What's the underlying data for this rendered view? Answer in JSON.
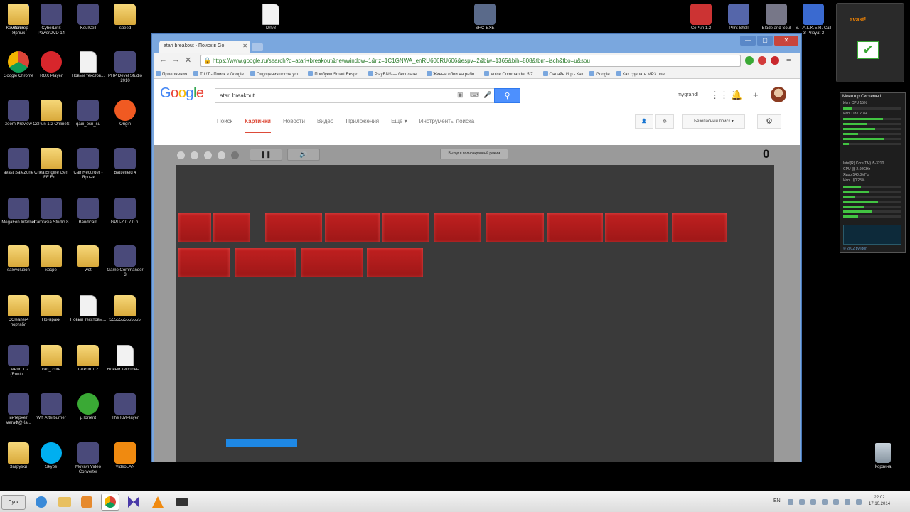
{
  "desktop": {
    "icons": [
      {
        "label": "Компьютер - Ярлык",
        "type": "computer",
        "col": 0,
        "row": 0
      },
      {
        "label": "CyberLink PowerDVD 14",
        "type": "app",
        "col": 1,
        "row": 0
      },
      {
        "label": "KeulCell",
        "type": "app",
        "col": 2,
        "row": 0
      },
      {
        "label": "speed",
        "type": "folder",
        "col": 3,
        "row": 0
      },
      {
        "label": "Game",
        "type": "folder",
        "col": 4,
        "row": 0
      },
      {
        "label": "Google Chrome",
        "type": "chrome",
        "col": 0,
        "row": 1
      },
      {
        "label": "ROX Player",
        "type": "rox",
        "col": 1,
        "row": 1
      },
      {
        "label": "Новый текстов...",
        "type": "doc",
        "col": 2,
        "row": 1
      },
      {
        "label": "PHP Devel Studio 2010",
        "type": "app",
        "col": 3,
        "row": 1
      },
      {
        "label": "zoom Preview",
        "type": "app",
        "col": 0,
        "row": 2
      },
      {
        "label": "CePun 1.2 OnlineS",
        "type": "folder",
        "col": 1,
        "row": 2
      },
      {
        "label": "qaui_osn_su",
        "type": "app",
        "col": 2,
        "row": 2
      },
      {
        "label": "Origin",
        "type": "origin",
        "col": 3,
        "row": 2
      },
      {
        "label": "avast SafeZone",
        "type": "app",
        "col": 0,
        "row": 3
      },
      {
        "label": "CheatEngine Gen FE En...",
        "type": "folder",
        "col": 1,
        "row": 3
      },
      {
        "label": "CamRecorder - Ярлык",
        "type": "app",
        "col": 2,
        "row": 3
      },
      {
        "label": "Battlefield 4",
        "type": "app",
        "col": 3,
        "row": 3
      },
      {
        "label": "MegaFon Internet",
        "type": "app",
        "col": 0,
        "row": 4
      },
      {
        "label": "Camtasia Studio 8",
        "type": "app",
        "col": 1,
        "row": 4
      },
      {
        "label": "Bandicam",
        "type": "app",
        "col": 2,
        "row": 4
      },
      {
        "label": "GPU-Z.0.7.0.ru",
        "type": "app",
        "col": 3,
        "row": 4
      },
      {
        "label": "salevolution",
        "type": "folder",
        "col": 0,
        "row": 5
      },
      {
        "label": "косре",
        "type": "folder",
        "col": 1,
        "row": 5
      },
      {
        "label": "wot",
        "type": "folder",
        "col": 2,
        "row": 5
      },
      {
        "label": "Game Commander 3",
        "type": "app",
        "col": 3,
        "row": 5
      },
      {
        "label": "CCleaner4 портабл",
        "type": "folder",
        "col": 0,
        "row": 6
      },
      {
        "label": "Призраки",
        "type": "folder",
        "col": 1,
        "row": 6
      },
      {
        "label": "Новый текстовы...",
        "type": "doc",
        "col": 2,
        "row": 6
      },
      {
        "label": "5555555555555",
        "type": "folder",
        "col": 3,
        "row": 6
      },
      {
        "label": "CePun 1.2 (Runtu...",
        "type": "app",
        "col": 0,
        "row": 7
      },
      {
        "label": "can_ cure",
        "type": "folder",
        "col": 1,
        "row": 7
      },
      {
        "label": "CePun 1.2",
        "type": "folder",
        "col": 2,
        "row": 7
      },
      {
        "label": "Новый текстовы...",
        "type": "doc",
        "col": 3,
        "row": 7
      },
      {
        "label": "интернет мегаФ@Ка...",
        "type": "app",
        "col": 0,
        "row": 8
      },
      {
        "label": "Wifi Afterburner",
        "type": "app",
        "col": 1,
        "row": 8
      },
      {
        "label": "µTorrent",
        "type": "utorrent",
        "col": 2,
        "row": 8
      },
      {
        "label": "The KMPlayer",
        "type": "app",
        "col": 3,
        "row": 8
      },
      {
        "label": "Загрузки",
        "type": "folder",
        "col": 0,
        "row": 9
      },
      {
        "label": "Skype",
        "type": "skype",
        "col": 1,
        "row": 9
      },
      {
        "label": "Movavi Video Converter",
        "type": "app",
        "col": 2,
        "row": 9
      },
      {
        "label": "VideoLAN",
        "type": "vlc",
        "col": 3,
        "row": 9
      }
    ],
    "top_icons": [
      {
        "label": "Drlv8",
        "type": "doc"
      },
      {
        "label": "SHC-EXE",
        "type": "app"
      },
      {
        "label": "CePun 1.2",
        "type": "app"
      },
      {
        "label": "Print Shell",
        "type": "app"
      },
      {
        "label": "Blade and Soul",
        "type": "app"
      },
      {
        "label": "S.T.A.L.K.E.R. Call of Pripyat 2",
        "type": "app"
      }
    ],
    "recycle_bin": "Корзина"
  },
  "browser": {
    "tab_title": "atari breakout - Поиск в Go",
    "url": "https://www.google.ru/search?q=atari+breakout&newwindow=1&rlz=1C1GNWA_enRU606RU606&espv=2&biw=1365&bih=808&tbm=isch&tbo=u&sou",
    "bookmarks": [
      "Приложения",
      "TIL!T - Поиск в Google",
      "Ощущения после уст...",
      "Пробуем Smart Respo...",
      "PlayBNS — бесплатн...",
      "Живые обои на рабо...",
      "Voice Commander 5.7...",
      "Онлайн Игр - Как",
      "Google",
      "Как сделать MP3 пле..."
    ]
  },
  "google": {
    "logo": "Google",
    "search_value": "atari breakout",
    "user": "mygrandl",
    "tabs": [
      {
        "label": "Поиск",
        "active": false
      },
      {
        "label": "Картинки",
        "active": true
      },
      {
        "label": "Новости",
        "active": false
      },
      {
        "label": "Видео",
        "active": false
      },
      {
        "label": "Приложения",
        "active": false
      },
      {
        "label": "Еще ▾",
        "active": false
      },
      {
        "label": "Инструменты поиска",
        "active": false
      }
    ],
    "safe_search": "Безопасный поиск ▾"
  },
  "game": {
    "pause_symbol": "❚❚",
    "sound_symbol": "🔊",
    "fullscreen_label": "Выход в полноэкранный режим",
    "score": "0",
    "lives_total": 5,
    "lives_lost": 1,
    "bricks_row1": [
      1,
      1,
      1,
      1,
      1,
      1,
      1,
      1,
      1,
      1
    ],
    "bricks_row2": [
      1,
      1,
      1,
      1
    ],
    "paddle_color": "#1e88e5",
    "brick_color": "#b31b1b"
  },
  "widgets": {
    "avast_label": "avast!",
    "sysmon_title": "Монитор Системы II",
    "sysmon_rows": [
      "Исп. CPU 15%",
      "Исп. ОЗУ 2.7/4",
      "Intel(R) Core(TM) i5-3210",
      "CPU @ 2.60GHz",
      "Ядро 540.8МГц",
      "Исп. ЦП 28%"
    ],
    "sysmon_footer": "© 2012 by Igor"
  },
  "taskbar": {
    "start_label": "Пуск",
    "lang": "EN",
    "time": "22:02",
    "date": "17.10.2014"
  }
}
